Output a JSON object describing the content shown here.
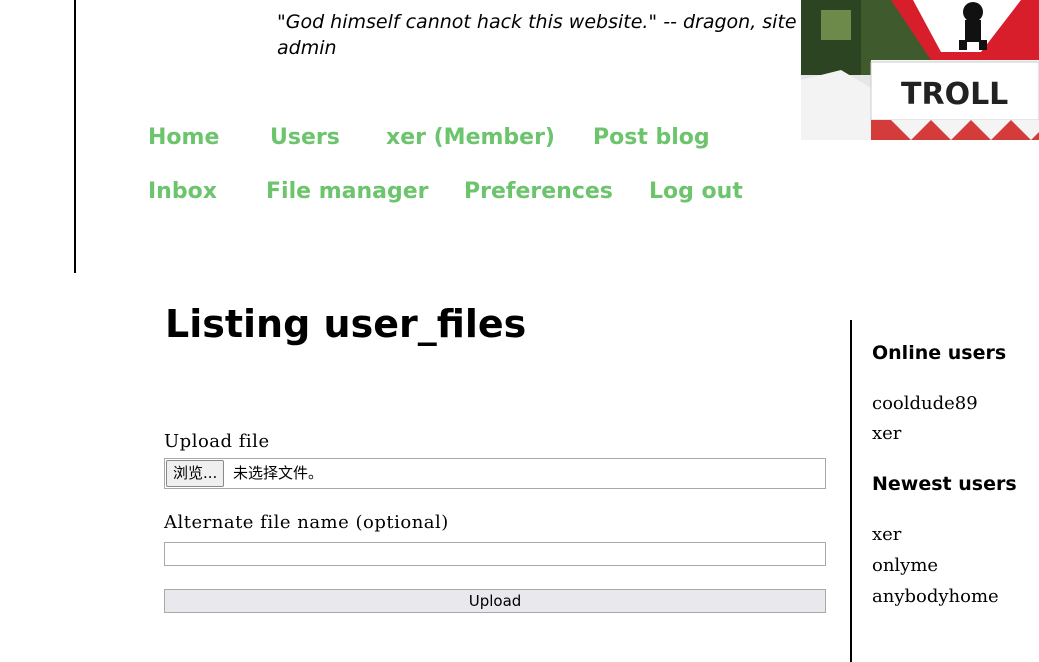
{
  "header": {
    "quote": "\"God himself cannot hack this website.\" -- dragon, site admin",
    "logo_sign_text": "TROLL"
  },
  "nav": {
    "home": "Home",
    "users": "Users",
    "member": "xer (Member)",
    "post_blog": "Post blog",
    "inbox": "Inbox",
    "file_manager": "File manager",
    "preferences": "Preferences",
    "log_out": "Log out",
    "link_color": "#6cc46c"
  },
  "main": {
    "title": "Listing user_files",
    "upload_label": "Upload file",
    "browse_label": "浏览...",
    "no_file_text": "未选择文件。",
    "alt_name_label": "Alternate file name (optional)",
    "alt_name_value": "",
    "upload_button": "Upload"
  },
  "sidebar": {
    "online_title": "Online users",
    "online_users": [
      "cooldude89",
      "xer"
    ],
    "newest_title": "Newest users",
    "newest_users": [
      "xer",
      "onlyme",
      "anybodyhome"
    ]
  }
}
